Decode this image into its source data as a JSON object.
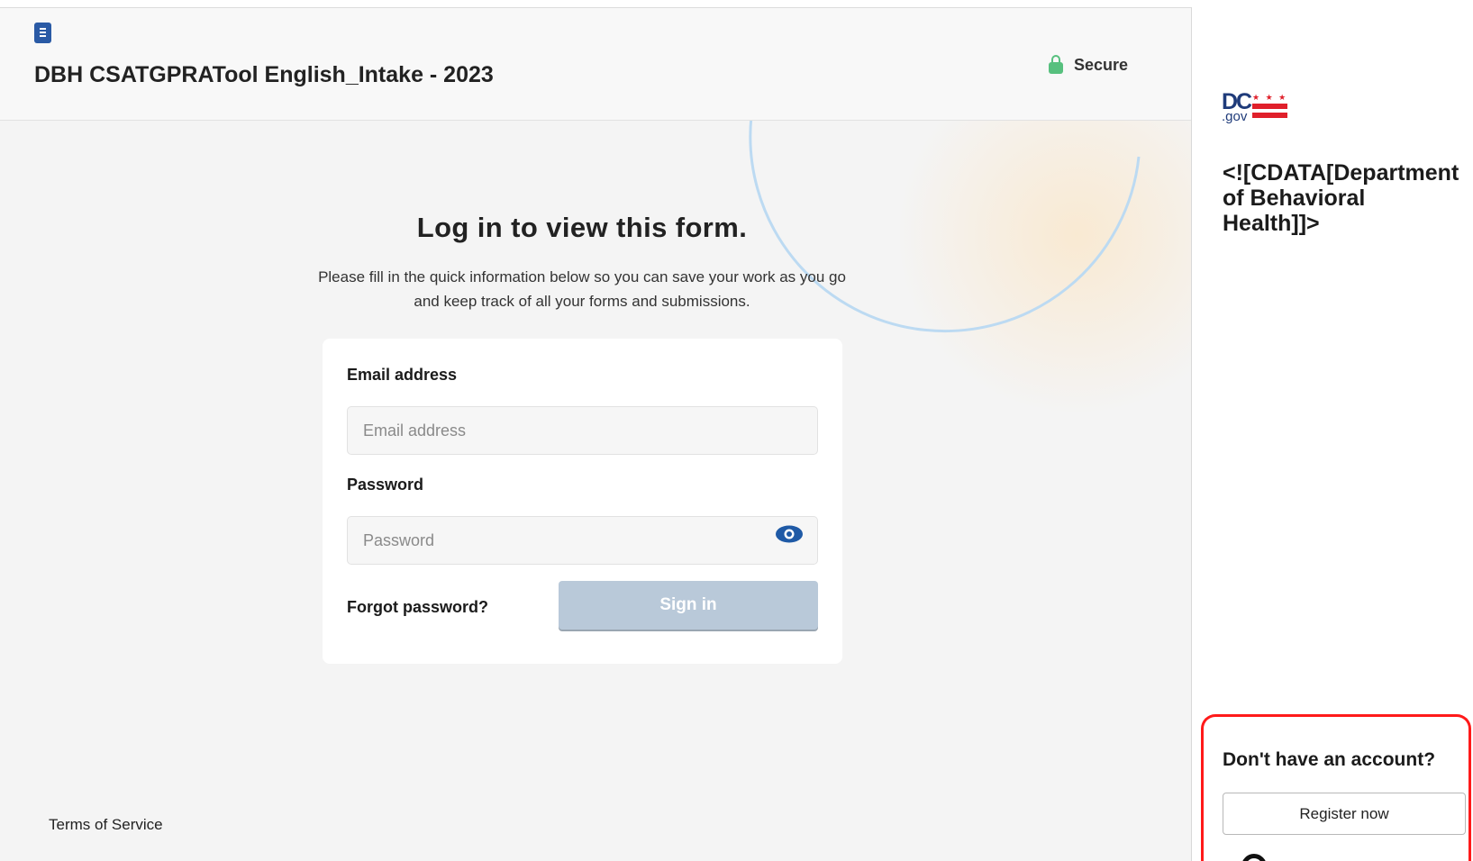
{
  "header": {
    "form_title": "DBH CSATGPRATool English_Intake - 2023",
    "secure_label": "Secure",
    "doc_icon": "document-icon",
    "lock_icon": "lock-icon"
  },
  "login": {
    "heading": "Log in to view this form.",
    "subtitle": "Please fill in the quick information below so you can save your work as you go and keep track of all your forms and submissions.",
    "email_label": "Email address",
    "email_placeholder": "Email address",
    "email_value": "",
    "password_label": "Password",
    "password_placeholder": "Password",
    "password_value": "",
    "eye_icon": "eye-icon",
    "forgot_label": "Forgot password?",
    "signin_label": "Sign in"
  },
  "footer": {
    "terms_label": "Terms of Service"
  },
  "sidebar": {
    "logo_text": "DC",
    "logo_suffix": ".gov",
    "logo_stars": "★ ★ ★",
    "org_name": "<![CDATA[Department of Behavioral Health]]>",
    "no_account_label": "Don't have an account?",
    "register_label": "Register now"
  },
  "colors": {
    "accent_blue": "#1f5aa6",
    "secure_green": "#57c07e",
    "signin_disabled": "#b9c9d9",
    "highlight_red": "#ff1a1a",
    "dc_red": "#e0202b",
    "dc_navy": "#1f3b7a"
  }
}
